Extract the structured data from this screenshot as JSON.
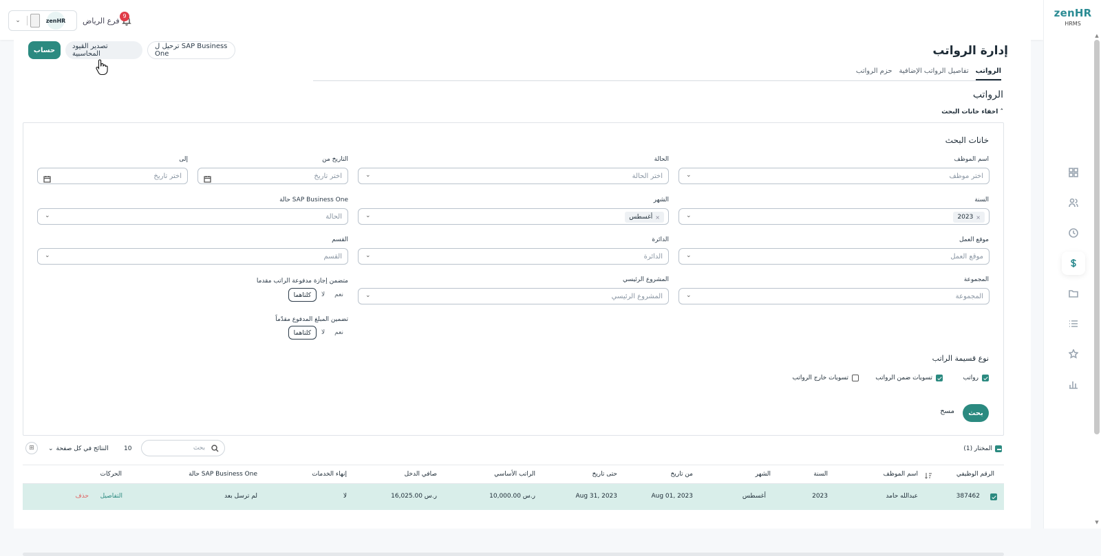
{
  "brand": {
    "logo_main": "zen",
    "logo_accent": "HR",
    "sub": "HRMS"
  },
  "topbar": {
    "branch": "فرع الرياض",
    "notifications": "9",
    "mini_logo": "zenHR"
  },
  "page": {
    "title": "إدارة الرواتب",
    "buttons": {
      "calculate": "حساب",
      "export": "تصدير القيود المحاسبية",
      "sap": "ترحيل ل SAP Business One"
    },
    "tabs": [
      "الرواتب",
      "تفاصيل الرواتب الإضافية",
      "حزم الرواتب"
    ],
    "section_title": "الرواتب",
    "hide_search": "اخفاء خانات البحث ˄"
  },
  "search": {
    "title": "خانات البحث",
    "employee_name": {
      "label": "اسم الموظف",
      "placeholder": "اختر موظف"
    },
    "status": {
      "label": "الحالة",
      "placeholder": "اختر الحالة"
    },
    "date_from": {
      "label": "التاريخ من",
      "placeholder": "اختر تاريخ"
    },
    "date_to": {
      "label": "إلى",
      "placeholder": "اختر تاريخ"
    },
    "year": {
      "label": "السنة",
      "value": "2023"
    },
    "month": {
      "label": "الشهر",
      "value": "أغسطس"
    },
    "sap_status": {
      "label": "حالة SAP Business One",
      "placeholder": "الحالة"
    },
    "work_location": {
      "label": "موقع العمل",
      "placeholder": "موقع العمل"
    },
    "department": {
      "label": "الدائرة",
      "placeholder": "الدائرة"
    },
    "section": {
      "label": "القسم",
      "placeholder": "القسم"
    },
    "group": {
      "label": "المجموعة",
      "placeholder": "المجموعة"
    },
    "main_project": {
      "label": "المشروع الرئيسي",
      "placeholder": "المشروع الرئيسي"
    },
    "include_paid_leave": {
      "label": "متضمن إجازة مدفوعة الراتب مقدما",
      "options": [
        "نعم",
        "لا",
        "كلتاهما"
      ],
      "selected": "كلتاهما"
    },
    "include_advance": {
      "label": "تضمين المبلغ المدفوع مقدّماً",
      "options": [
        "نعم",
        "لا",
        "كلتاهما"
      ],
      "selected": "كلتاهما"
    },
    "payment_type": {
      "title": "نوع قسيمة الراتب",
      "options": [
        {
          "label": "رواتب",
          "checked": true
        },
        {
          "label": "تسويات ضمن الرواتب",
          "checked": true
        },
        {
          "label": "تسويات خارج الرواتب",
          "checked": false
        }
      ]
    },
    "search_btn": "بحث",
    "clear_btn": "مسح"
  },
  "table_toolbar": {
    "selected": "المختار (1)",
    "search_placeholder": "بحث",
    "per_page_value": "10",
    "per_page_label": "النتائج في كل صفحة"
  },
  "table": {
    "columns": [
      "الرقم الوظيفي",
      "اسم الموظف",
      "السنة",
      "الشهر",
      "من تاريخ",
      "حتى تاريخ",
      "الراتب الأساسي",
      "صافي الدخل",
      "إنهاء الخدمات",
      "حالة SAP Business One",
      "الحركات"
    ],
    "rows": [
      {
        "id": "387462",
        "name": "عبدالله حامد",
        "year": "2023",
        "month": "أغسطس",
        "from": "Aug 01, 2023",
        "to": "Aug 31, 2023",
        "basic": "10,000.00 ر.س",
        "net": "16,025.00 ر.س",
        "termination": "لا",
        "sap_status": "لم ترسل بعد",
        "details": "التفاصيل",
        "delete": "حذف"
      }
    ]
  },
  "colors": {
    "primary": "#2b8a80",
    "danger": "#e03b47",
    "row_selected": "#d9eeea"
  }
}
